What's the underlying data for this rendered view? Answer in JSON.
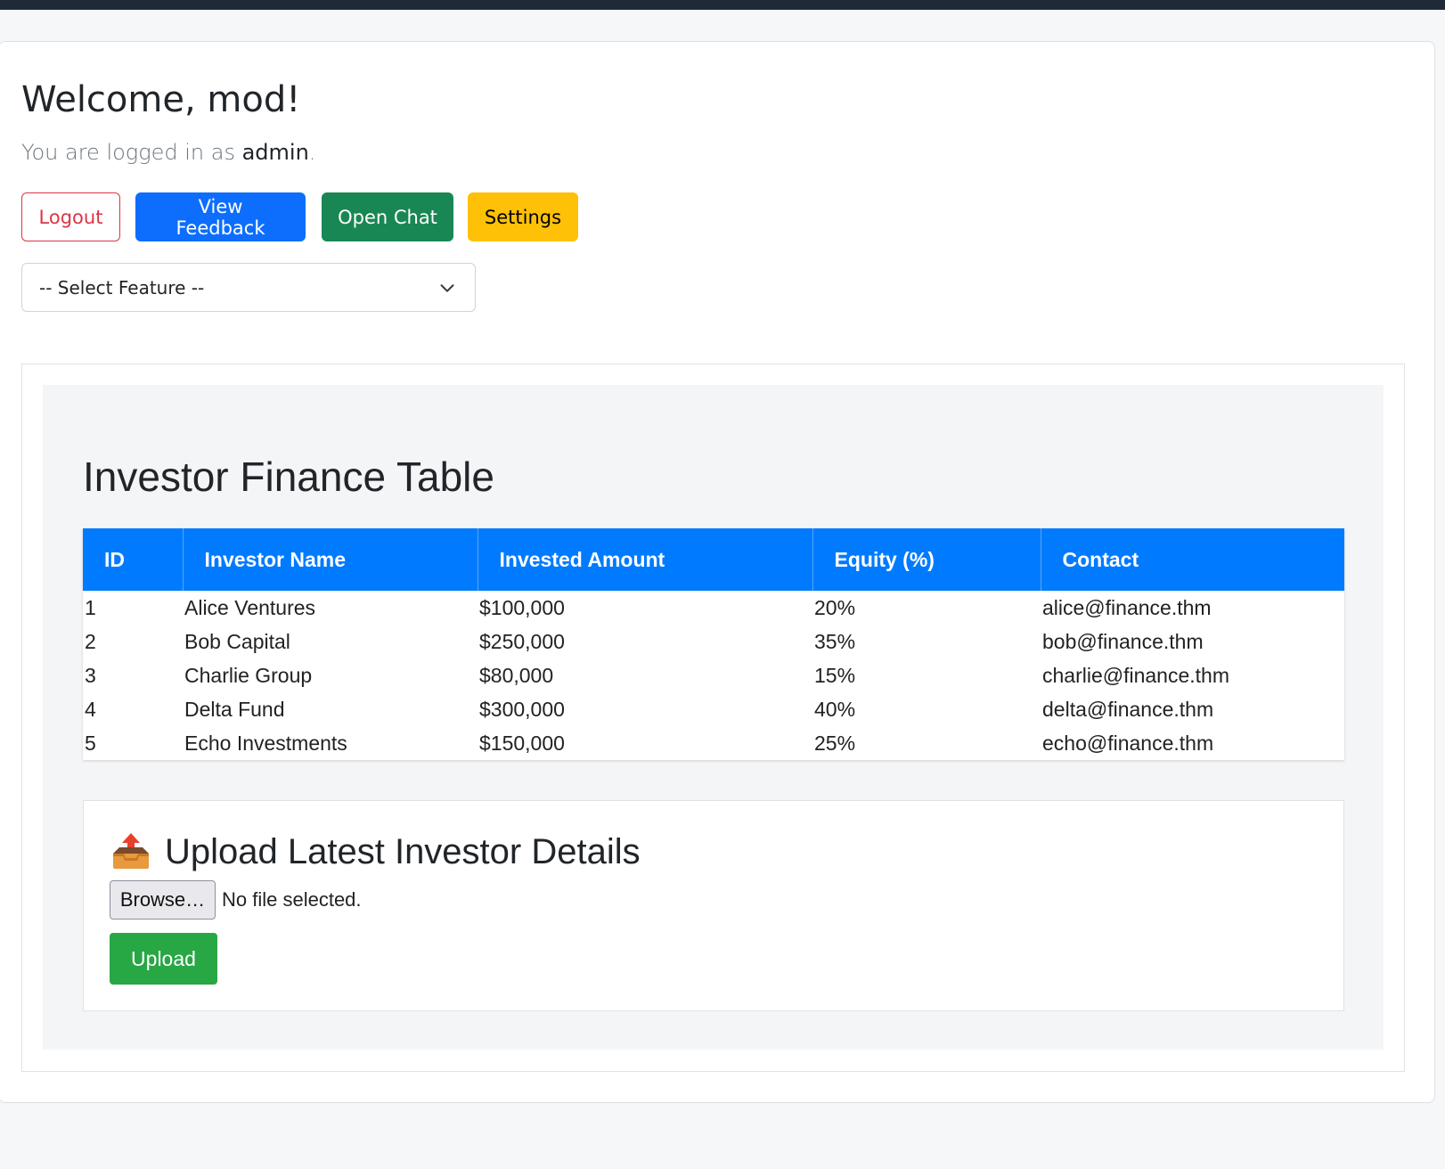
{
  "header": {
    "welcome": "Welcome, mod!",
    "logged_prefix": "You are logged in as ",
    "role": "admin",
    "logged_suffix": "."
  },
  "actions": {
    "logout": "Logout",
    "view_feedback": "View Feedback",
    "open_chat": "Open Chat",
    "settings": "Settings"
  },
  "feature_select": {
    "selected": "-- Select Feature --"
  },
  "finance": {
    "title": "Investor Finance Table",
    "columns": [
      "ID",
      "Investor Name",
      "Invested Amount",
      "Equity (%)",
      "Contact"
    ],
    "rows": [
      [
        "1",
        "Alice Ventures",
        "$100,000",
        "20%",
        "alice@finance.thm"
      ],
      [
        "2",
        "Bob Capital",
        "$250,000",
        "35%",
        "bob@finance.thm"
      ],
      [
        "3",
        "Charlie Group",
        "$80,000",
        "15%",
        "charlie@finance.thm"
      ],
      [
        "4",
        "Delta Fund",
        "$300,000",
        "40%",
        "delta@finance.thm"
      ],
      [
        "5",
        "Echo Investments",
        "$150,000",
        "25%",
        "echo@finance.thm"
      ]
    ]
  },
  "upload": {
    "icon": "outbox-tray-icon",
    "title": "Upload Latest Investor Details",
    "browse": "Browse…",
    "no_file": "No file selected.",
    "button": "Upload"
  },
  "colors": {
    "topbar": "#1f2937",
    "table_header": "#007bff",
    "logout": "#dc3545",
    "feedback": "#0d6efd",
    "chat": "#198754",
    "settings": "#ffc107",
    "upload": "#28a745"
  }
}
